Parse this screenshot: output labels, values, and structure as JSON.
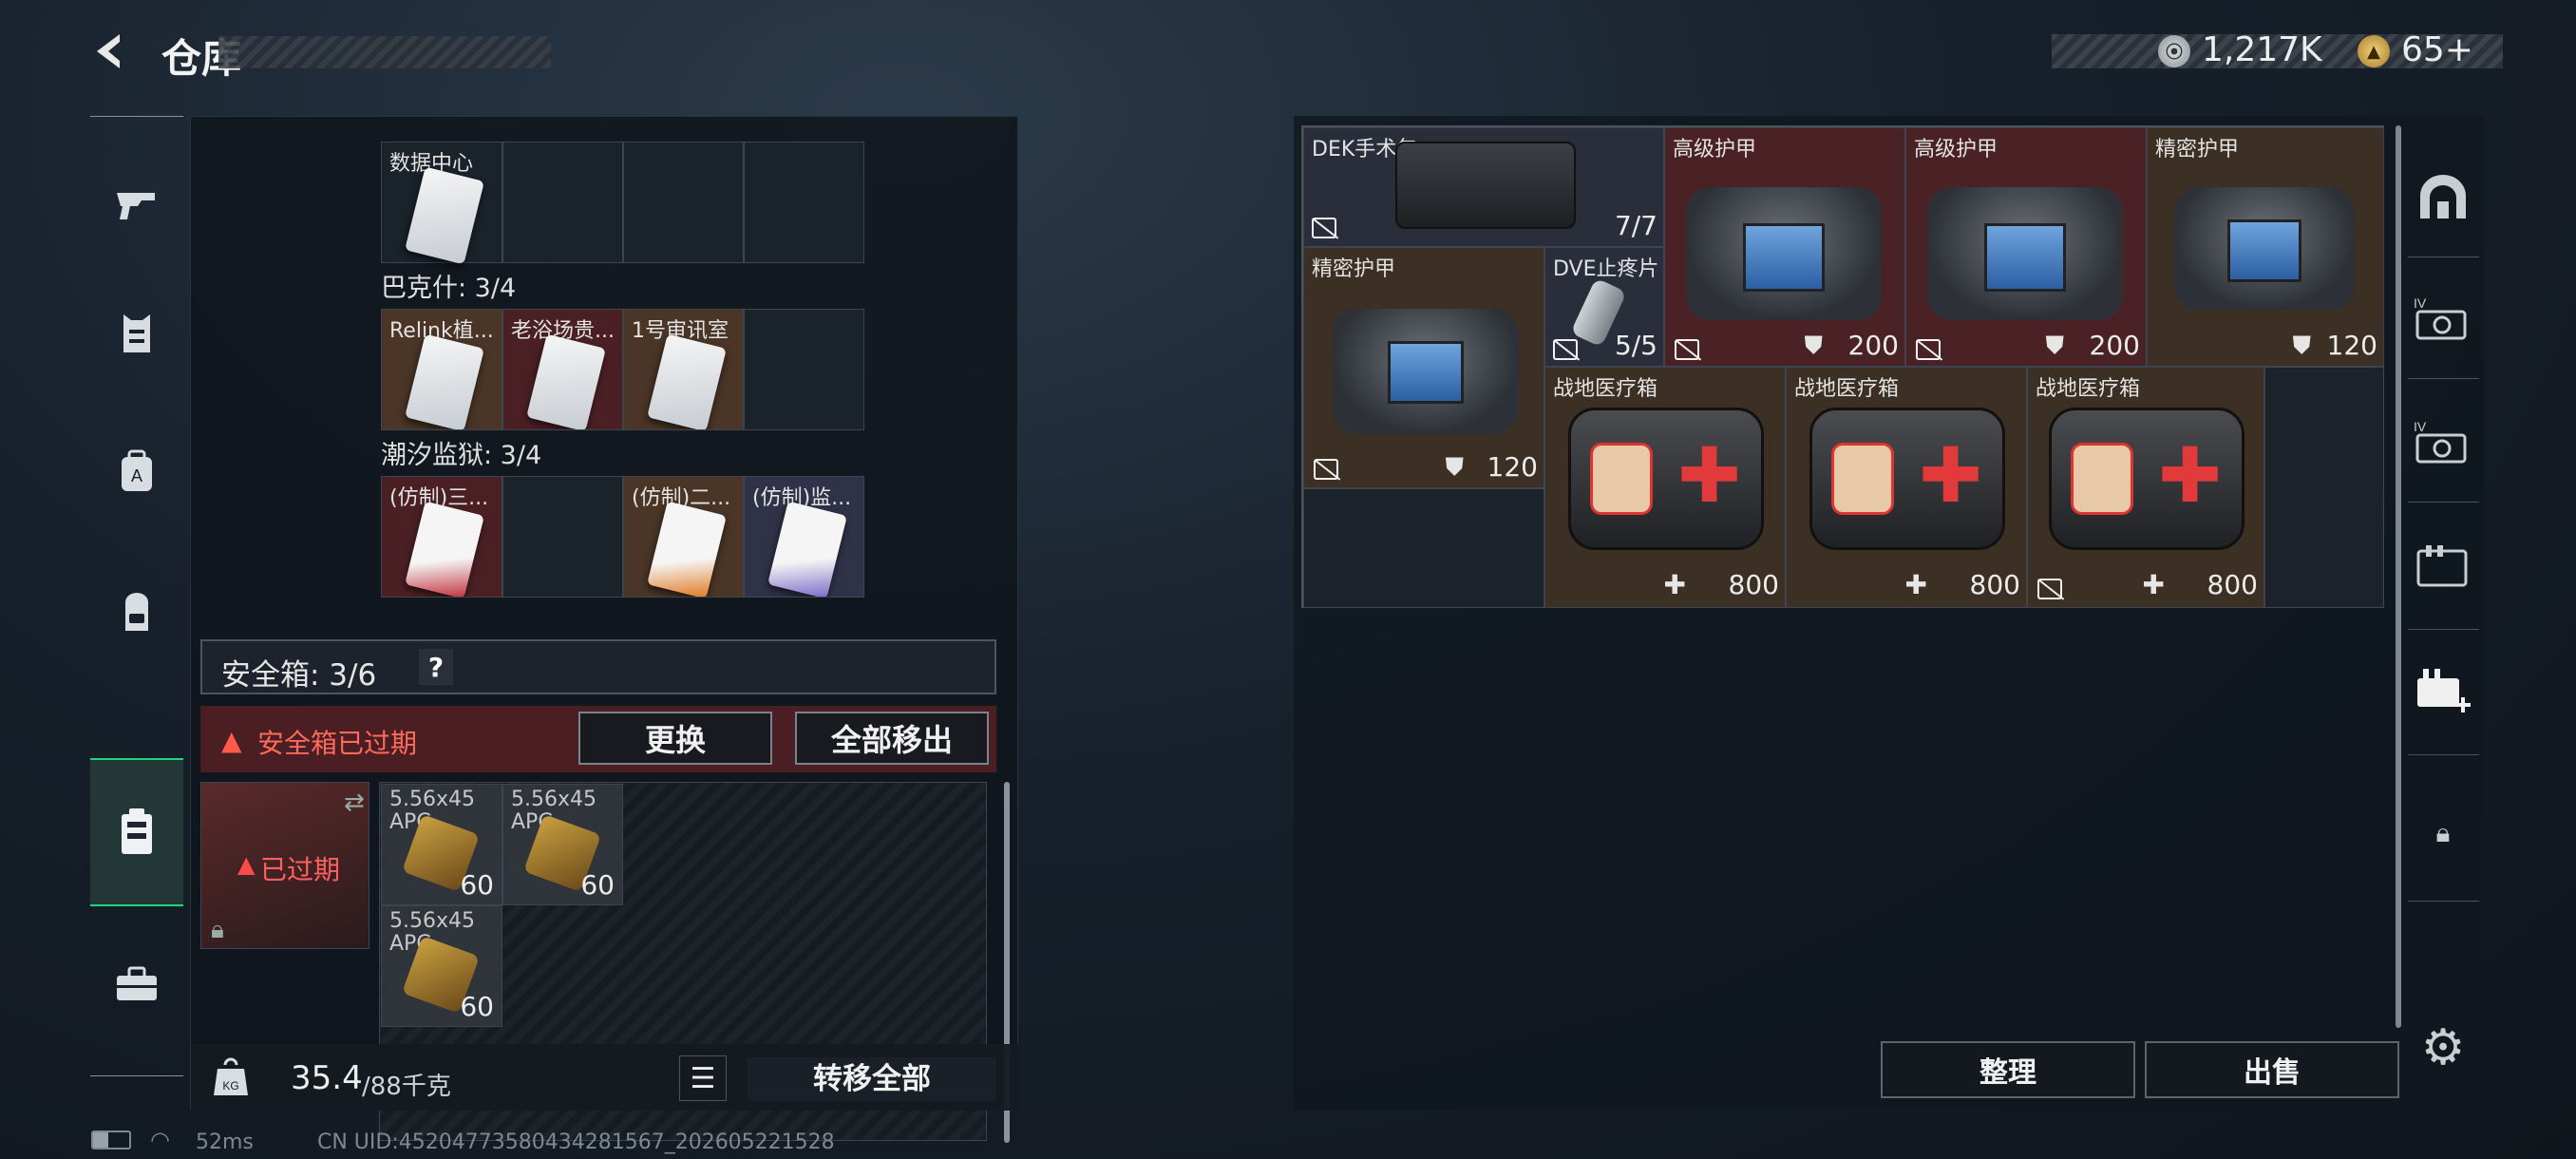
{
  "header": {
    "title": "仓库",
    "currency": [
      {
        "icon": "silver-coin-icon",
        "value": "1,217K"
      },
      {
        "icon": "gold-coin-icon",
        "value": "65+"
      }
    ]
  },
  "sidebar": {
    "items": [
      {
        "name": "weapon-icon"
      },
      {
        "name": "armor-vest-icon"
      },
      {
        "name": "backpack-icon"
      },
      {
        "name": "chest-rig-icon"
      },
      {
        "name": "safebox-icon",
        "active": true
      },
      {
        "name": "toolbox-icon"
      }
    ]
  },
  "left": {
    "top_row": [
      {
        "label": "数据中心"
      }
    ],
    "sections": [
      {
        "title": "巴克什: 3/4",
        "cells": [
          {
            "label": "Relink植..."
          },
          {
            "label": "老浴场贵..."
          },
          {
            "label": "1号审讯室"
          }
        ]
      },
      {
        "title": "潮汐监狱: 3/4",
        "cells": [
          {
            "label": "(仿制)三..."
          },
          {
            "label": ""
          },
          {
            "label": "(仿制)二..."
          },
          {
            "label": "(仿制)监..."
          }
        ]
      }
    ],
    "safebox": {
      "title": "安全箱: 3/6",
      "help": "?",
      "warning": "安全箱已过期",
      "replace": "更换",
      "move_all": "全部移出",
      "expired": "已过期"
    },
    "ammo": [
      {
        "label": "5.56x45 APC",
        "count": "60"
      },
      {
        "label": "5.56x45 APC",
        "count": "60"
      },
      {
        "label": "5.56x45 APC",
        "count": "60"
      }
    ],
    "footer": {
      "weight": "35.4",
      "capacity": "/88千克",
      "transfer": "转移全部"
    }
  },
  "right": {
    "items": [
      {
        "label": "DEK手术包",
        "count": "7/7"
      },
      {
        "label": "高级护甲",
        "value": "200"
      },
      {
        "label": "高级护甲",
        "value": "200"
      },
      {
        "label": "精密护甲",
        "value": "120"
      },
      {
        "label": "精密护甲",
        "value": "120"
      },
      {
        "label": "DVE止疼片",
        "count": "5/5"
      },
      {
        "label": "战地医疗箱",
        "value": "800"
      },
      {
        "label": "战地医疗箱",
        "value": "800"
      },
      {
        "label": "战地医疗箱",
        "value": "800"
      }
    ],
    "sort": "整理",
    "sell": "出售"
  },
  "status": {
    "ping": "52ms",
    "uid": "CN UID:452047735804342815​67_202605221528"
  },
  "colors": {
    "accent": "#1fd47a",
    "danger": "#e0473b",
    "armor_bg": "#4a2226",
    "armor2_bg": "#3c2f24"
  }
}
